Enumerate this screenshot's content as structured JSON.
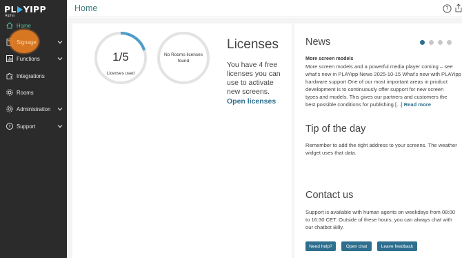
{
  "app": {
    "logo_text_left": "PL",
    "logo_text_right": "YIPP",
    "logo_sub": "Alpha",
    "page_title": "Home"
  },
  "sidebar": {
    "items": [
      {
        "label": "Home",
        "icon": "home-icon",
        "has_chevron": false,
        "active": true
      },
      {
        "label": "Signage",
        "icon": "signage-icon",
        "has_chevron": true,
        "active": false
      },
      {
        "label": "Functions",
        "icon": "functions-icon",
        "has_chevron": true,
        "active": false
      },
      {
        "label": "Integrations",
        "icon": "puzzle-icon",
        "has_chevron": false,
        "active": false
      },
      {
        "label": "Rooms",
        "icon": "gear-icon",
        "has_chevron": false,
        "active": false
      },
      {
        "label": "Administration",
        "icon": "gear-icon",
        "has_chevron": true,
        "active": false
      },
      {
        "label": "Support",
        "icon": "question-icon",
        "has_chevron": true,
        "active": false
      }
    ]
  },
  "licenses_widget": {
    "used_value": "1/5",
    "used_label": "Licenses used",
    "used_fraction": 0.2,
    "rooms_label": "No Rooms licenses found",
    "title": "Licenses",
    "text": "You have 4 free licenses you can use to activate new screens.",
    "link": "Open licenses"
  },
  "news": {
    "title": "News",
    "dots": 4,
    "active_dot": 0,
    "headline": "More screen models",
    "body_lines": [
      "More screen models and a powerful media player coming – see",
      "what's new in PLAYipp News 2025-10-15 What's new with PLAYipp",
      "hardware support One of our most important areas in product",
      "development is to continuously offer support for new screen",
      "types and models. This gives our partners and customers the",
      "best possible conditions for publishing [...]"
    ],
    "read_more": "Read more"
  },
  "tip": {
    "title": "Tip of the day",
    "body_lines": [
      "Remember to add the right address to your screens. The weather",
      "widget uses that data."
    ]
  },
  "contact": {
    "title": "Contact us",
    "body_lines": [
      "Support is available with human agents on weekdays from 08:00",
      "to 16:30 CET. Outside of these hours, you can always chat with",
      "our chatbot Billy."
    ],
    "buttons": [
      "Need help?",
      "Open chat",
      "Leave feedback"
    ]
  },
  "colors": {
    "sidebar_bg": "#2b2b2b",
    "accent_green": "#57c09b",
    "accent_blue": "#2e6e8e",
    "highlight_orange": "#e67e22",
    "ring_gray": "#e3e3e3",
    "ring_progress": "#4f9ec9"
  }
}
